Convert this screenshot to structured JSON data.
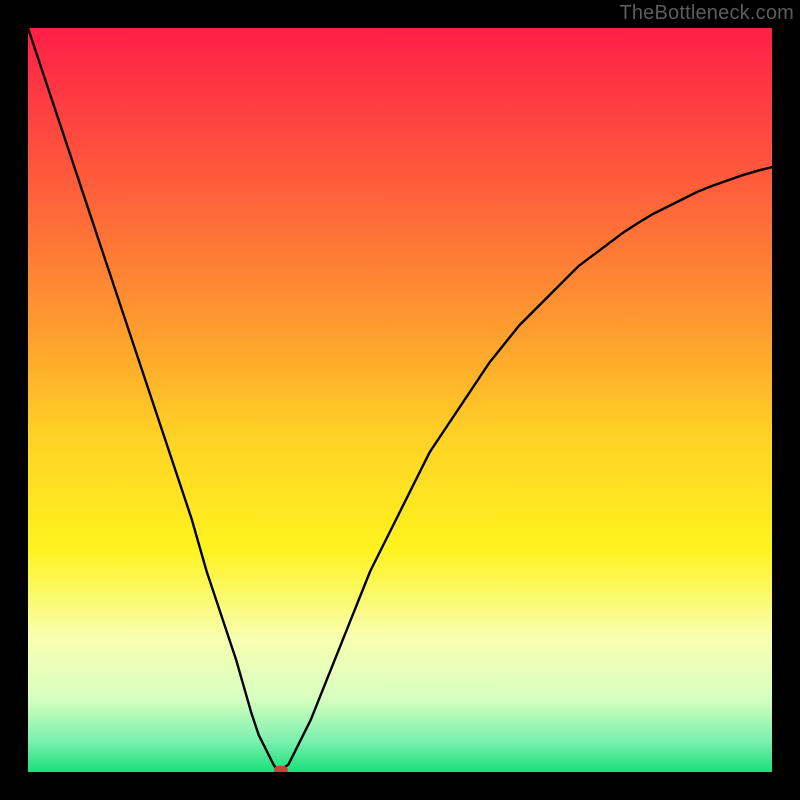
{
  "watermark": "TheBottleneck.com",
  "chart_data": {
    "type": "line",
    "title": "",
    "xlabel": "",
    "ylabel": "",
    "xlim": [
      0,
      100
    ],
    "ylim": [
      0,
      100
    ],
    "x": [
      0,
      2,
      4,
      6,
      8,
      10,
      12,
      14,
      16,
      18,
      20,
      22,
      24,
      26,
      28,
      30,
      31,
      32,
      33,
      33.5,
      34,
      35,
      36,
      38,
      40,
      42,
      44,
      46,
      48,
      50,
      52,
      54,
      56,
      58,
      60,
      62,
      64,
      66,
      68,
      70,
      72,
      74,
      76,
      78,
      80,
      82,
      84,
      86,
      88,
      90,
      92,
      94,
      96,
      98,
      100
    ],
    "y": [
      100,
      94,
      88,
      82,
      76,
      70,
      64,
      58,
      52,
      46,
      40,
      34,
      27,
      21,
      15,
      8,
      5,
      3,
      1,
      0.3,
      0.3,
      1,
      3,
      7,
      12,
      17,
      22,
      27,
      31,
      35,
      39,
      43,
      46,
      49,
      52,
      55,
      57.5,
      60,
      62,
      64,
      66,
      68,
      69.5,
      71,
      72.5,
      73.8,
      75,
      76,
      77,
      78,
      78.8,
      79.5,
      80.2,
      80.8,
      81.3
    ],
    "annotations": [
      {
        "type": "marker",
        "shape": "pill",
        "x": 34,
        "y": 0.3,
        "color": "#b94a3a"
      }
    ],
    "background": {
      "type": "gradient-vertical",
      "stops": [
        {
          "pos": 0.0,
          "color": "#ff1f47"
        },
        {
          "pos": 0.2,
          "color": "#ff5a3c"
        },
        {
          "pos": 0.4,
          "color": "#ff9a2f"
        },
        {
          "pos": 0.55,
          "color": "#ffd225"
        },
        {
          "pos": 0.7,
          "color": "#fff31f"
        },
        {
          "pos": 0.82,
          "color": "#f8ffb0"
        },
        {
          "pos": 0.9,
          "color": "#d8ffc0"
        },
        {
          "pos": 0.96,
          "color": "#78efae"
        },
        {
          "pos": 1.0,
          "color": "#18e07a"
        }
      ]
    }
  }
}
